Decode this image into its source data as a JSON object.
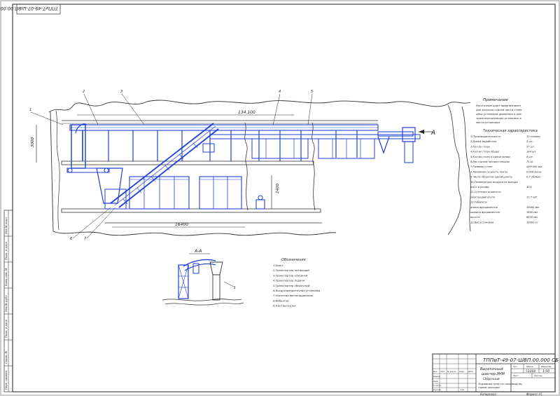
{
  "stamp_code": "ТППиТ-49-07-ШВП.00.000 СБ",
  "stamp_code_rotated": "ТППиТ-49-07-ШВП.00.000 СБ",
  "title_block": {
    "name_line1": "Высоточный",
    "name_line2": "шахтер ЭНМ",
    "name_line3": "Сборочный",
    "mass": "51000",
    "scale": "1:50",
    "org_line1": "Подземный пункт по производству",
    "org_line2": "горной проходки",
    "copied": "Копировал",
    "format": "Формат А1"
  },
  "callouts": [
    "1",
    "2",
    "3",
    "4",
    "5",
    "6",
    "7"
  ],
  "view_label": "А",
  "section_label": "А-А",
  "dimensions": {
    "total_length": "134.100",
    "upper_height": "3000",
    "lower_height": "2400",
    "bottom_length": "16400"
  },
  "notes": {
    "heading": "Примечание",
    "lines": [
      "Расстояние шахт предназначен",
      "для высоких горной насти стоек",
      "цеха установки движения в цех",
      "транспортирующих установок в",
      "места установки"
    ]
  },
  "tech": {
    "heading": "Техническая характеристика",
    "rows": [
      {
        "label": "1.Производительность",
        "value": "10 т/смену"
      },
      {
        "label": "2.Длина выработки",
        "value": "2 шт."
      },
      {
        "label": "3.Кол-во стоек",
        "value": "27 шт."
      },
      {
        "label": "4.Кол-во стоек общее",
        "value": "184 шт."
      },
      {
        "label": "5.Кол-во стоек в одной линии",
        "value": "8 шт."
      },
      {
        "label": "6.Вес горной на одну секцию",
        "value": "75 кг"
      },
      {
        "label": "7.Размеры стоек",
        "value": "400*400 мм"
      },
      {
        "label": "8.Линейная скорость ленты",
        "value": "0.026 м/сек"
      },
      {
        "label": "9.Число оборотов одной шахты",
        "value": "0.7 об/мин"
      },
      {
        "label": "10.Температура воздуха на выходе",
        "value": ""
      },
      {
        "label": "шахт в шкафу",
        "value": "40 С"
      },
      {
        "label": "11.Суточная мощность",
        "value": ""
      },
      {
        "label": "электродвигателя",
        "value": "10.7 кВт"
      },
      {
        "label": "12.Габариты",
        "value": ""
      },
      {
        "label": "длина фундаментов",
        "value": "38000 мм"
      },
      {
        "label": "ширина фундаментов",
        "value": "3600 мм"
      },
      {
        "label": "высота",
        "value": "6930 мм"
      },
      {
        "label": "13.Вес установки",
        "value": "33000 кг"
      }
    ]
  },
  "legend": {
    "heading": "Обозначения",
    "items": [
      "1.Шахт",
      "2.Транспортер питающий",
      "3.Транспортер основной",
      "4.Транспортер подачи",
      "5.Транспортер сборочный",
      "6.Воздухораздаточная установка",
      "7.Насосная вентиляционная",
      "8.Вибратор",
      "9.Узел выгрузки"
    ]
  },
  "side_strip": {
    "labels": [
      "Инв.№ подл.",
      "Подп. и дата",
      "Взам. инв. №",
      "Инв.№ дубл.",
      "Подп. и дата",
      "Справ. №",
      "Перв. примен."
    ]
  },
  "tb_headers": [
    "Изм.",
    "Лист",
    "№ докум.",
    "Подп.",
    "Дата",
    "Разраб.",
    "Пров.",
    "Т.контр.",
    "Н.контр.",
    "Утв.",
    "Лит.",
    "Масса",
    "Масштаб",
    "Лист",
    "Листов"
  ]
}
